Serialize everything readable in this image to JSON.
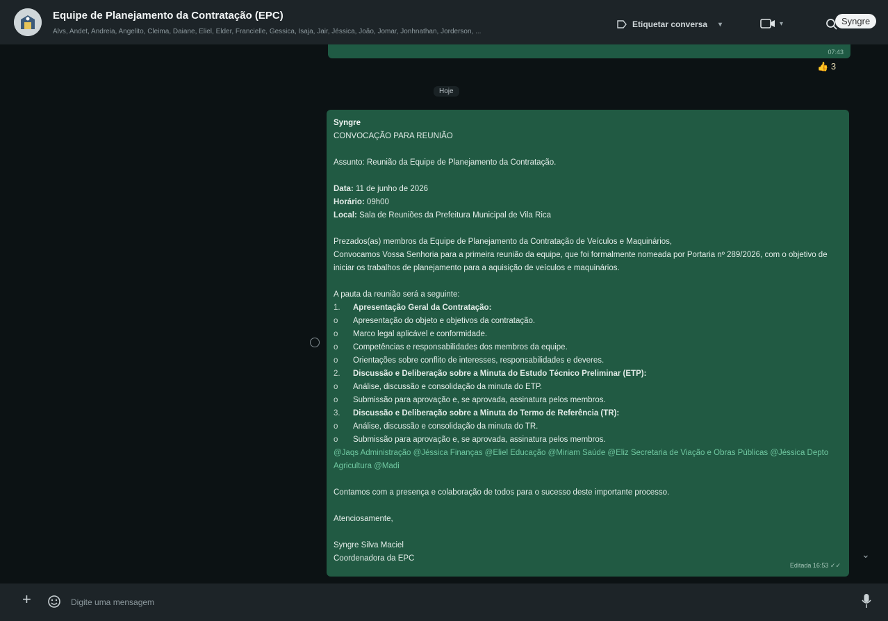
{
  "header": {
    "group_title": "Equipe de Planejamento da Contratação (EPC)",
    "members": "Alvs, Andet, Andreia, Angelito, Cleima, Daiane, Eliel, Elder, Francielle, Gessica, Isaja, Jair, Jéssica, João, Jomar, Jonhnathan, Jorderson, ...",
    "tag_label": "Etiquetar conversa",
    "user_name": "Syngre"
  },
  "chat": {
    "prev_time": "07:43",
    "reaction_emoji": "👍",
    "reaction_count": "3",
    "day_label": "Hoje",
    "message": {
      "sender": "Syngre",
      "heading": "CONVOCAÇÃO PARA REUNIÃO",
      "subject": "Assunto: Reunião da Equipe de Planejamento da Contratação.",
      "date_label": "Data:",
      "date_value": " 11 de junho de 2026",
      "time_label": "Horário:",
      "time_value": " 09h00",
      "place_label": "Local:",
      "place_value": " Sala de Reuniões da Prefeitura Municipal de Vila Rica",
      "greeting": "Prezados(as) membros da Equipe de Planejamento da Contratação de Veículos e Maquinários,",
      "body": "Convocamos Vossa Senhoria para a primeira reunião da equipe, que foi formalmente nomeada por Portaria nº 289/2026, com o objetivo de iniciar os trabalhos de planejamento para a aquisição de veículos e maquinários.",
      "agenda_intro": "A pauta da reunião será a seguinte:",
      "agenda": [
        {
          "marker": "1.",
          "text": "Apresentação Geral da Contratação:",
          "bold": true
        },
        {
          "marker": "o",
          "text": "Apresentação do objeto e objetivos da contratação.",
          "bold": false
        },
        {
          "marker": "o",
          "text": "Marco legal aplicável e conformidade.",
          "bold": false
        },
        {
          "marker": "o",
          "text": "Competências e responsabilidades dos membros da equipe.",
          "bold": false
        },
        {
          "marker": "o",
          "text": "Orientações sobre conflito de interesses, responsabilidades e deveres.",
          "bold": false
        },
        {
          "marker": "2.",
          "text": "Discussão e Deliberação sobre a Minuta do Estudo Técnico Preliminar (ETP):",
          "bold": true
        },
        {
          "marker": "o",
          "text": "Análise, discussão e consolidação da minuta do ETP.",
          "bold": false
        },
        {
          "marker": "o",
          "text": "Submissão para aprovação e, se aprovada, assinatura pelos membros.",
          "bold": false
        },
        {
          "marker": "3.",
          "text": "Discussão e Deliberação sobre a Minuta do Termo de Referência (TR):",
          "bold": true
        },
        {
          "marker": "o",
          "text": "Análise, discussão e consolidação da minuta do TR.",
          "bold": false
        },
        {
          "marker": "o",
          "text": "Submissão para aprovação e, se aprovada, assinatura pelos membros.",
          "bold": false
        }
      ],
      "mentions": "@Jaqs Administração @Jéssica Finanças @Eliel Educação @Miriam Saúde @Eliz Secretaria de Viação e Obras Públicas @Jéssica Depto Agricultura @Madi",
      "closing": "Contamos com a presença e colaboração de todos para o sucesso deste importante processo.",
      "regards": "Atenciosamente,",
      "signature_name": "Syngre Silva Maciel",
      "signature_role": "Coordenadora da EPC",
      "meta": "Editada 16:53 ✓✓"
    }
  },
  "composer": {
    "placeholder": "Digite uma mensagem"
  },
  "colors": {
    "bubble": "#215a43",
    "mention": "#6fc7a0",
    "background": "#0c1214"
  }
}
